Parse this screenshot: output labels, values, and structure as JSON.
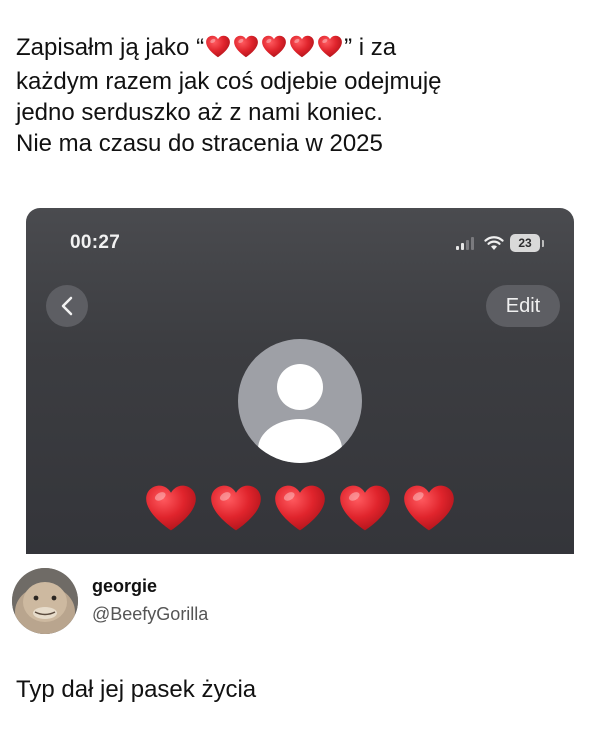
{
  "caption": {
    "line1_before": "Zapisałm ją jako “",
    "line1_after": "” i za",
    "line2": "każdym razem jak coś odjebie odejmuję",
    "line3": "jedno serduszko aż z nami koniec.",
    "line4": "Nie ma czasu do stracenia w 2025",
    "inline_heart_count": 5
  },
  "phone": {
    "status_time": "00:27",
    "battery": "23",
    "edit_label": "Edit",
    "contact_hearts": 5
  },
  "tweet": {
    "display_name": "georgie",
    "handle": "@BeefyGorilla",
    "text": "Typ dał jej pasek życia"
  },
  "colors": {
    "heart": "#e0242c",
    "phone_bg": "#3c3d41",
    "button_bg": "#5d5e63",
    "avatar_bg": "#9ea0a6"
  }
}
